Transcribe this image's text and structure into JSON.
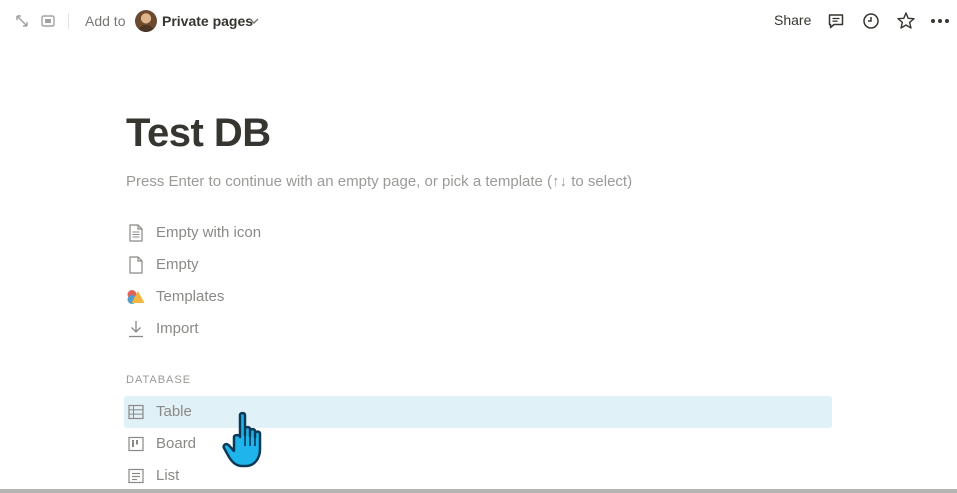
{
  "topbar": {
    "add_to": "Add to",
    "workspace": "Private pages",
    "share": "Share",
    "icons": [
      "expand-icon",
      "peek-mode-icon",
      "chevron-down-icon",
      "comment-icon",
      "clock-icon",
      "star-icon",
      "more-icon"
    ]
  },
  "page": {
    "title": "Test DB",
    "hint": "Press Enter to continue with an empty page, or pick a template (↑↓ to select)"
  },
  "options": [
    {
      "label": "Empty with icon",
      "icon": "page-text-icon"
    },
    {
      "label": "Empty",
      "icon": "page-icon"
    },
    {
      "label": "Templates",
      "icon": "templates-icon"
    },
    {
      "label": "Import",
      "icon": "import-icon"
    }
  ],
  "database": {
    "heading": "DATABASE",
    "items": [
      {
        "label": "Table",
        "icon": "table-icon",
        "highlighted": true
      },
      {
        "label": "Board",
        "icon": "board-icon"
      },
      {
        "label": "List",
        "icon": "list-icon"
      }
    ]
  },
  "colors": {
    "text": "#37352f",
    "muted": "#9b9a97",
    "highlight": "#e1f1f8",
    "cursor": "#1fb5ec"
  }
}
